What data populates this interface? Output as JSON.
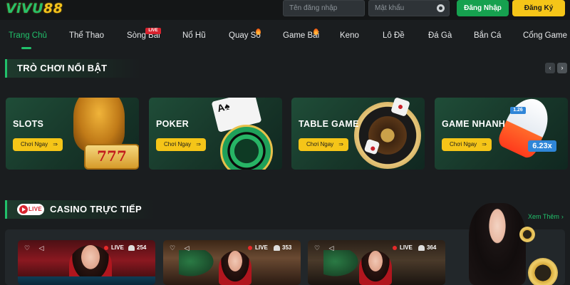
{
  "header": {
    "logo_prefix": "ViVU",
    "logo_suffix": "88",
    "username_placeholder": "Tên đăng nhập",
    "password_placeholder": "Mật khẩu",
    "login_label": "Đăng Nhập",
    "register_label": "Đăng Ký"
  },
  "nav": {
    "items": [
      {
        "label": "Trang Chủ",
        "active": true
      },
      {
        "label": "Thể Thao"
      },
      {
        "label": "Sòng Bài",
        "badge": "LIVE"
      },
      {
        "label": "Nổ Hũ"
      },
      {
        "label": "Quay Số",
        "icon": "fire-icon"
      },
      {
        "label": "Game Bài",
        "icon": "fire-icon"
      },
      {
        "label": "Keno"
      },
      {
        "label": "Lô Đề"
      },
      {
        "label": "Đá Gà"
      },
      {
        "label": "Bắn Cá"
      },
      {
        "label": "Cổng Game"
      }
    ]
  },
  "featured": {
    "title": "TRÒ CHƠI NỔI BẬT",
    "cards": [
      {
        "name": "SLOTS",
        "cta": "Chơi Ngay",
        "illustration": "slots-icon",
        "reel": "777"
      },
      {
        "name": "POKER",
        "cta": "Chơi Ngay",
        "illustration": "poker-chip-icon",
        "card": "A♠"
      },
      {
        "name": "TABLE GAME",
        "cta": "Chơi Ngay",
        "illustration": "roulette-icon"
      },
      {
        "name": "GAME NHANH",
        "cta": "Chơi Ngay",
        "illustration": "rocket-icon",
        "multiplier": "6.23x",
        "multiplier_small": "1.26"
      }
    ],
    "nav_prev": "‹",
    "nav_next": "›"
  },
  "casino": {
    "live_label": "LIVE",
    "title": "CASINO TRỰC TIẾP",
    "see_more": "Xem Thêm",
    "tables": [
      {
        "live": "LIVE",
        "viewers": "254"
      },
      {
        "live": "LIVE",
        "viewers": "353"
      },
      {
        "live": "LIVE",
        "viewers": "364"
      }
    ]
  },
  "colors": {
    "brand_green": "#21c16b",
    "brand_gold": "#f5c518",
    "live_red": "#d7232e"
  }
}
